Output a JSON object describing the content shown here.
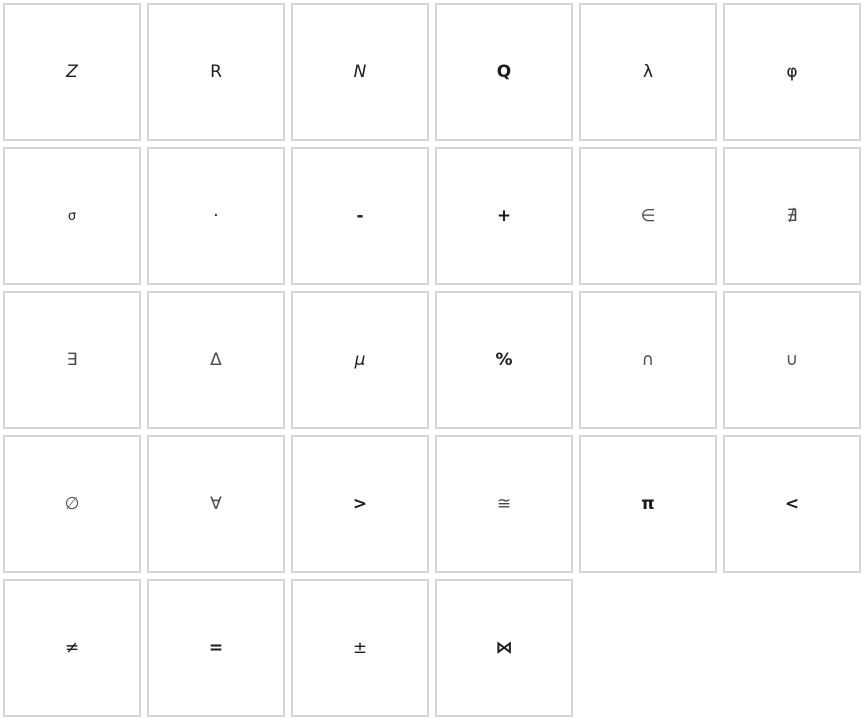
{
  "symbols": [
    {
      "label": "Z",
      "style": "italic"
    },
    {
      "label": "R",
      "style": ""
    },
    {
      "label": "N",
      "style": "italic"
    },
    {
      "label": "Q",
      "style": "bold"
    },
    {
      "label": "λ",
      "style": ""
    },
    {
      "label": "φ",
      "style": ""
    },
    {
      "label": "σ",
      "style": "small"
    },
    {
      "label": "·",
      "style": ""
    },
    {
      "label": "-",
      "style": "bold"
    },
    {
      "label": "+",
      "style": "bold"
    },
    {
      "label": "∈",
      "style": "thin"
    },
    {
      "label": "∄",
      "style": "thin"
    },
    {
      "label": "∃",
      "style": "thin"
    },
    {
      "label": "Δ",
      "style": "thin"
    },
    {
      "label": "μ",
      "style": "italic"
    },
    {
      "label": "%",
      "style": "bold"
    },
    {
      "label": "∩",
      "style": "thin"
    },
    {
      "label": "∪",
      "style": "thin"
    },
    {
      "label": "∅",
      "style": "thin"
    },
    {
      "label": "∀",
      "style": "thin"
    },
    {
      "label": ">",
      "style": "bold"
    },
    {
      "label": "≅",
      "style": "thin"
    },
    {
      "label": "π",
      "style": "bold"
    },
    {
      "label": "<",
      "style": "bold"
    },
    {
      "label": "≠",
      "style": ""
    },
    {
      "label": "=",
      "style": "bold"
    },
    {
      "label": "±",
      "style": ""
    },
    {
      "label": "⋈",
      "style": "bold"
    }
  ],
  "colors": {
    "background": "#ffffff",
    "tile_border": "#d4d4d4",
    "glyph": "#1c1c1c"
  }
}
